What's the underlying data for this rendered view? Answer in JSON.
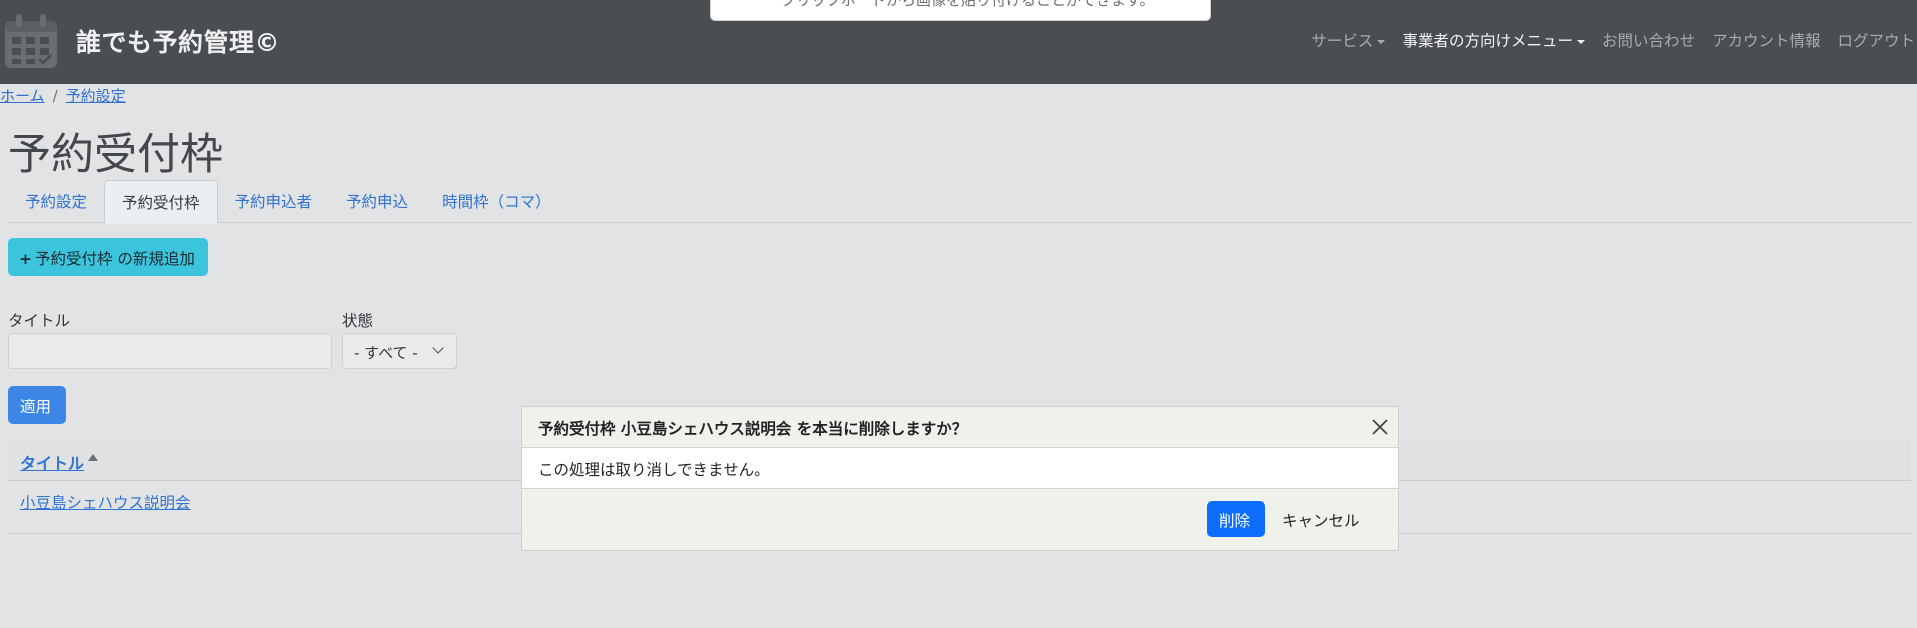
{
  "header": {
    "brand": "誰でも予約管理©",
    "nav": [
      {
        "label": "サービス"
      },
      {
        "label": "事業者の方向けメニュー"
      },
      {
        "label": "お問い合わせ"
      },
      {
        "label": "アカウント情報"
      },
      {
        "label": "ログアウト"
      }
    ]
  },
  "toast": {
    "text": "クリップボードから画像を貼り付けることができます。"
  },
  "breadcrumb": {
    "home": "ホーム",
    "separator": "/",
    "current": "予約設定"
  },
  "page_title": "予約受付枠",
  "tabs": [
    {
      "label": "予約設定"
    },
    {
      "label": "予約受付枠"
    },
    {
      "label": "予約申込者"
    },
    {
      "label": "予約申込"
    },
    {
      "label": "時間枠（コマ）"
    }
  ],
  "add_button": {
    "plus": "+",
    "label": "予約受付枠 の新規追加"
  },
  "filters": {
    "title_label": "タイトル",
    "title_value": "",
    "status_label": "状態",
    "status_value": "- すべて -",
    "apply_label": "適用"
  },
  "table": {
    "header_title": "タイトル",
    "rows": [
      {
        "title": "小豆島シェハウス説明会"
      }
    ]
  },
  "modal": {
    "title": "予約受付枠 小豆島シェハウス説明会 を本当に削除しますか？",
    "body": "この処理は取り消しできません。",
    "delete_label": "削除",
    "cancel_label": "キャンセル"
  },
  "colors": {
    "header_bg": "#4a4d51",
    "page_bg": "#e2e3e5",
    "link": "#2f73d4",
    "add_button": "#3cc4dc",
    "primary": "#0d6efd"
  }
}
